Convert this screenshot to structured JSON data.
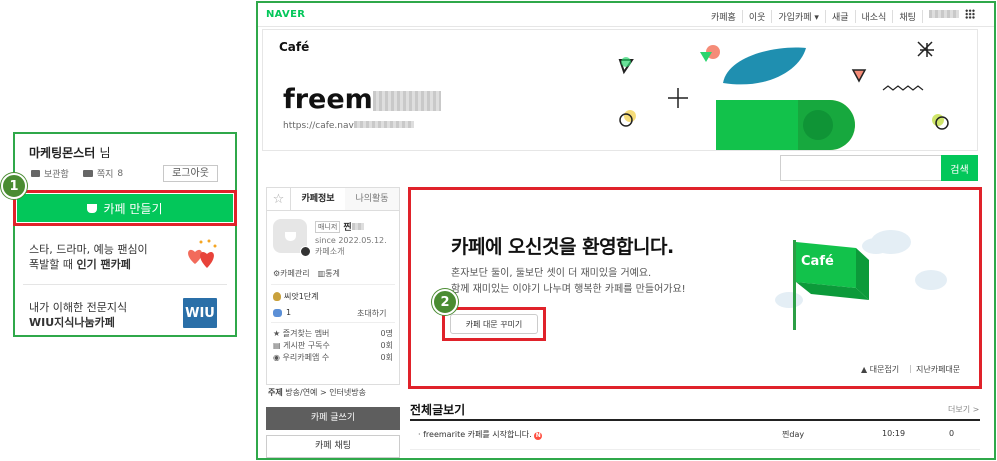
{
  "left_panel": {
    "username": "마케팅몬스터",
    "honorific": "님",
    "storage_label": "보관함",
    "notes_label": "쪽지",
    "notes_count": "8",
    "logout_label": "로그아웃",
    "create_cafe_label": "카페 만들기",
    "badge_number": "1",
    "promo1_line1": "스타, 드라마, 예능 팬심이",
    "promo1_line2_pre": "폭발할 때 ",
    "promo1_line2_bold": "인기 팬카페",
    "promo2_line1": "내가 이해한 전문지식",
    "promo2_line2": "WIU지식나눔카페",
    "wiu_logo_text": "WIU"
  },
  "gnb": {
    "logo": "NAVER",
    "items": [
      "카페홈",
      "이웃",
      "가입카페",
      "새글",
      "내소식",
      "채팅"
    ]
  },
  "cafe_header": {
    "brand": "Café",
    "name_visible": "freem",
    "url_visible": "https://cafe.nav"
  },
  "search": {
    "button_label": "검색",
    "placeholder": ""
  },
  "sidebar": {
    "tab_info": "카페정보",
    "tab_activity": "나의활동",
    "manager_badge": "매니저",
    "manager_name": "찐",
    "since": "since 2022.05.12.",
    "intro_link": "카페소개",
    "manage_link": "카페관리",
    "stats_link": "통계",
    "level": "씨앗1단계",
    "member_count": "1",
    "invite_label": "초대하기",
    "stats": [
      {
        "label": "즐겨찾는 멤버",
        "value": "0명"
      },
      {
        "label": "게시판 구독수",
        "value": "0회"
      },
      {
        "label": "우리카페앱 수",
        "value": "0회"
      }
    ],
    "topic_label": "주제",
    "topic_value": "방송/연예 > 인터넷방송",
    "write_button": "카페 글쓰기",
    "chat_button": "카페 채팅"
  },
  "welcome": {
    "title": "카페에 오신것을 환영합니다.",
    "line1": "혼자보단 둘이, 둘보단 셋이 더 재미있을 거예요.",
    "line2": "함께 재미있는 이야기 나누며 행복한 카페를 만들어가요!",
    "decorate_button": "카페 대문 꾸미기",
    "badge_number": "2",
    "flag_text": "Café",
    "fold_link": "대문접기",
    "separator": "|",
    "prev_link": "지난카페대문"
  },
  "posts": {
    "title": "전체글보기",
    "more_link": "더보기 >",
    "rows": [
      {
        "title": "freemarite 카페를 시작합니다.",
        "new_badge": "N",
        "author": "찐day",
        "time": "10:19",
        "views": "0"
      }
    ]
  },
  "colors": {
    "naver_green": "#03c75a",
    "frame_green": "#2fa84a",
    "highlight_red": "#e0222a",
    "badge_green": "#4a8c32"
  }
}
